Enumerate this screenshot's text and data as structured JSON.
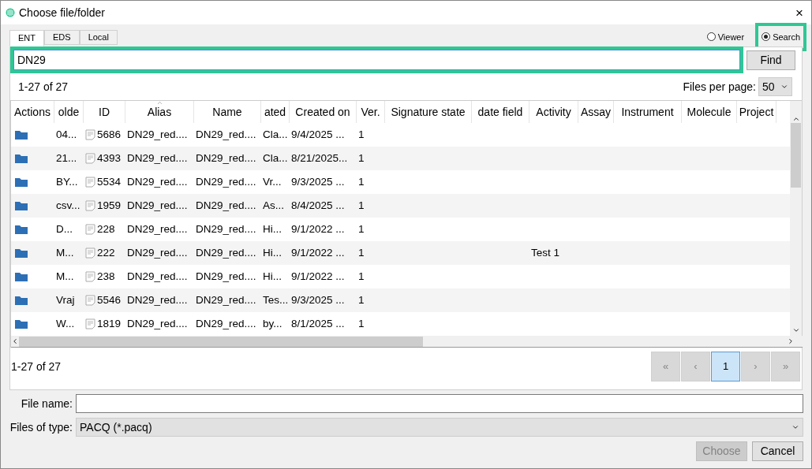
{
  "window": {
    "title": "Choose file/folder",
    "close": "×"
  },
  "tabs": [
    {
      "label": "ENT",
      "selected": true
    },
    {
      "label": "EDS",
      "selected": false
    },
    {
      "label": "Local",
      "selected": false
    }
  ],
  "mode": [
    {
      "label": "Viewer",
      "selected": false,
      "highlighted": false
    },
    {
      "label": "Search",
      "selected": true,
      "highlighted": true
    }
  ],
  "search": {
    "value": "DN29",
    "highlighted": true,
    "button": "Find"
  },
  "count_top": "1-27 of 27",
  "files_per_page": {
    "label": "Files per page:",
    "value": "50"
  },
  "table": {
    "columns": [
      {
        "label": "Actions",
        "sorted": false
      },
      {
        "label": "olde",
        "sorted": false
      },
      {
        "label": "ID",
        "sorted": false
      },
      {
        "label": "Alias",
        "sorted": true
      },
      {
        "label": "Name",
        "sorted": false
      },
      {
        "label": "ated",
        "sorted": false
      },
      {
        "label": "Created on",
        "sorted": false
      },
      {
        "label": "Ver.",
        "sorted": false
      },
      {
        "label": "Signature state",
        "sorted": false
      },
      {
        "label": "date field",
        "sorted": false
      },
      {
        "label": "Activity",
        "sorted": false
      },
      {
        "label": "Assay",
        "sorted": false
      },
      {
        "label": "Instrument",
        "sorted": false
      },
      {
        "label": "Molecule",
        "sorted": false
      },
      {
        "label": "Project",
        "sorted": false
      }
    ],
    "rows": [
      {
        "folder": "04...",
        "id": "5686",
        "alias": "DN29_red....",
        "name": "DN29_red....",
        "column_6": "Cla...",
        "created_on": "9/4/2025 ...",
        "ver": "1"
      },
      {
        "folder": "21...",
        "id": "4393",
        "alias": "DN29_red....",
        "name": "DN29_red....",
        "column_6": "Cla...",
        "created_on": "8/21/2025...",
        "ver": "1"
      },
      {
        "folder": "BY...",
        "id": "5534",
        "alias": "DN29_red....",
        "name": "DN29_red....",
        "column_6": "Vr...",
        "created_on": "9/3/2025 ...",
        "ver": "1"
      },
      {
        "folder": "csv...",
        "id": "1959",
        "alias": "DN29_red....",
        "name": "DN29_red....",
        "column_6": "As...",
        "created_on": "8/4/2025 ...",
        "ver": "1"
      },
      {
        "folder": "D...",
        "id": "228",
        "alias": "DN29_red....",
        "name": "DN29_red....",
        "column_6": "Hi...",
        "created_on": "9/1/2022 ...",
        "ver": "1"
      },
      {
        "folder": "M...",
        "id": "222",
        "alias": "DN29_red....",
        "name": "DN29_red....",
        "column_6": "Hi...",
        "created_on": "9/1/2022 ...",
        "ver": "1",
        "activity": "Test 1"
      },
      {
        "folder": "M...",
        "id": "238",
        "alias": "DN29_red....",
        "name": "DN29_red....",
        "column_6": "Hi...",
        "created_on": "9/1/2022 ...",
        "ver": "1"
      },
      {
        "folder": "Vraj",
        "id": "5546",
        "alias": "DN29_red....",
        "name": "DN29_red....",
        "column_6": "Tes...",
        "created_on": "9/3/2025 ...",
        "ver": "1"
      },
      {
        "folder": "W...",
        "id": "1819",
        "alias": "DN29_red....",
        "name": "DN29_red....",
        "column_6": "by...",
        "created_on": "8/1/2025 ...",
        "ver": "1"
      }
    ]
  },
  "count_bottom": "1-27 of 27",
  "pager": [
    {
      "label": "«",
      "selected": false
    },
    {
      "label": "‹",
      "selected": false
    },
    {
      "label": "1",
      "selected": true
    },
    {
      "label": "›",
      "selected": false
    },
    {
      "label": "»",
      "selected": false
    }
  ],
  "file_name": {
    "label": "File name:"
  },
  "file_type": {
    "label": "Files of type:",
    "value": "PACQ (*.pacq)"
  },
  "buttons": [
    {
      "label": "Choose",
      "disabled": true
    },
    {
      "label": "Cancel",
      "disabled": false
    }
  ]
}
